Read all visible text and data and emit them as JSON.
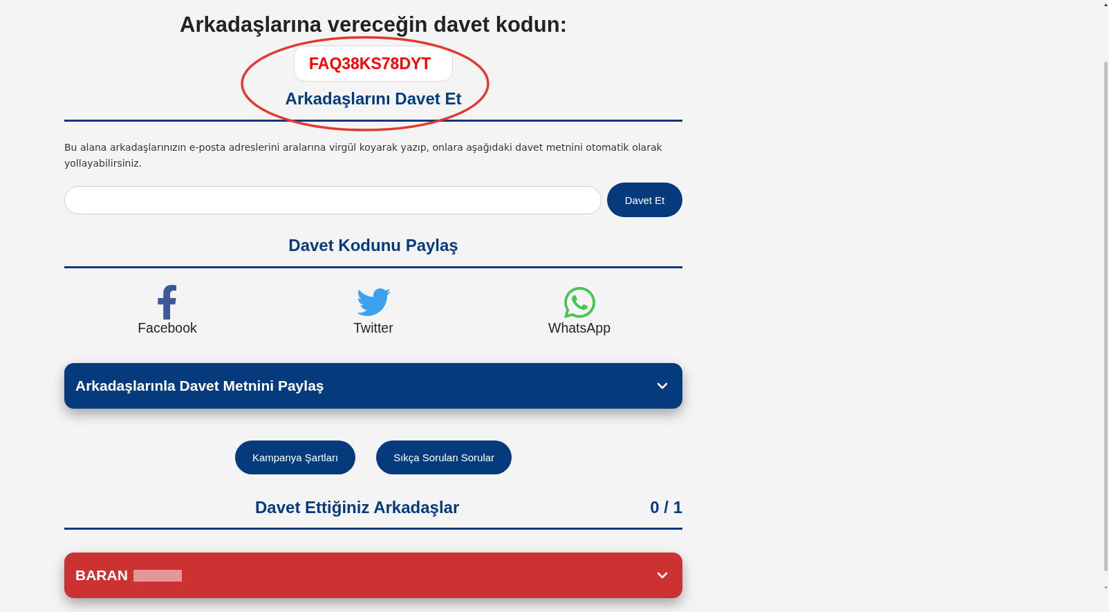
{
  "heading": "Arkadaşlarına vereceğin davet kodun:",
  "invite_code": {
    "value": "FAQ38KS78DYT",
    "circled": true
  },
  "invite_title": "Arkadaşlarını Davet Et",
  "email_invite": {
    "description": "Bu alana arkadaşlarınızın e-posta adreslerini aralarına virgül koyarak yazıp, onlara aşağıdaki davet metnini otomatik olarak yollayabilirsiniz.",
    "button": "Davet Et"
  },
  "share": {
    "title": "Davet Kodunu Paylaş",
    "items": [
      {
        "kind": "facebook",
        "label": "Facebook"
      },
      {
        "kind": "twitter",
        "label": "Twitter"
      },
      {
        "kind": "whatsapp",
        "label": "WhatsApp"
      }
    ]
  },
  "invite_text_panel": {
    "title": "Arkadaşlarınla Davet Metnini Paylaş",
    "expanded": false
  },
  "links": [
    "Kampanya Şartları",
    "Sıkça Sorulan Sorular"
  ],
  "friends": {
    "title": "Davet Ettiğiniz Arkadaşlar",
    "count": "0 / 1",
    "items": [
      {
        "name": "BARAN",
        "surname_redacted": true,
        "color": "#cc3232",
        "expanded": false
      }
    ]
  }
}
